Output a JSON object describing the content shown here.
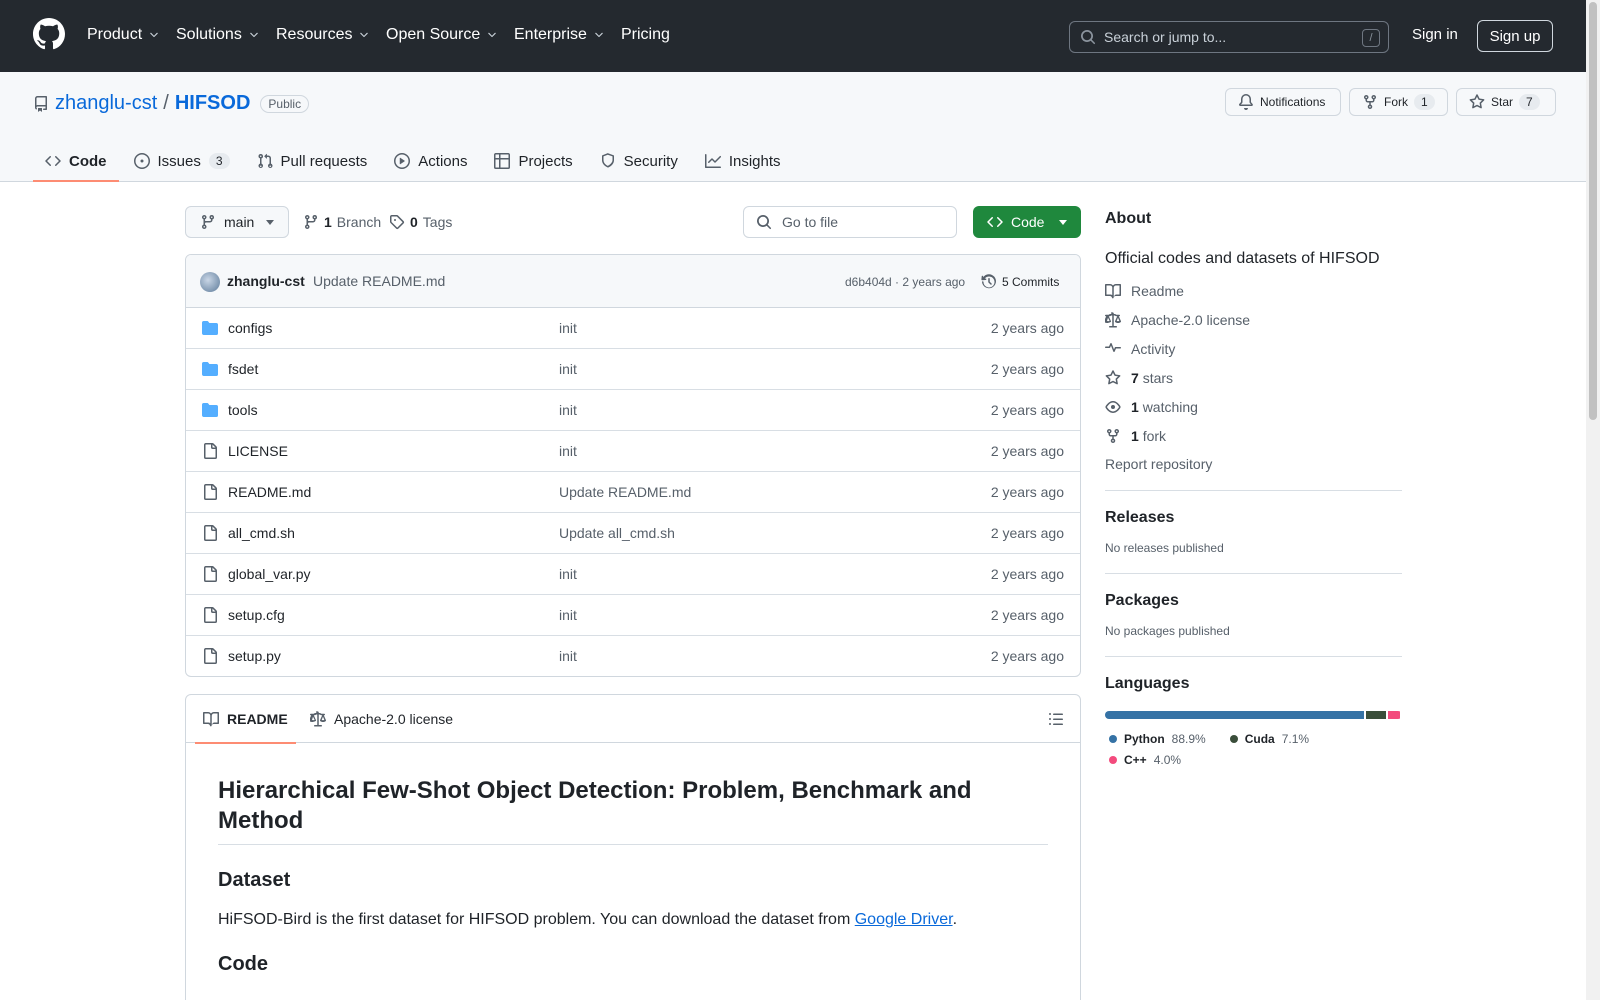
{
  "header": {
    "nav": [
      {
        "label": "Product",
        "dropdown": true
      },
      {
        "label": "Solutions",
        "dropdown": true
      },
      {
        "label": "Resources",
        "dropdown": true
      },
      {
        "label": "Open Source",
        "dropdown": true
      },
      {
        "label": "Enterprise",
        "dropdown": true
      },
      {
        "label": "Pricing",
        "dropdown": false
      }
    ],
    "search_placeholder": "Search or jump to...",
    "search_shortcut": "/",
    "sign_in": "Sign in",
    "sign_up": "Sign up"
  },
  "repo": {
    "owner": "zhanglu-cst",
    "separator": "/",
    "name": "HIFSOD",
    "visibility": "Public",
    "notifications_label": "Notifications",
    "fork_label": "Fork",
    "fork_count": "1",
    "star_label": "Star",
    "star_count": "7"
  },
  "tabs": [
    {
      "label": "Code",
      "icon": "code-icon",
      "active": true,
      "count": ""
    },
    {
      "label": "Issues",
      "icon": "issue-icon",
      "active": false,
      "count": "3"
    },
    {
      "label": "Pull requests",
      "icon": "pull-request-icon",
      "active": false,
      "count": ""
    },
    {
      "label": "Actions",
      "icon": "play-icon",
      "active": false,
      "count": ""
    },
    {
      "label": "Projects",
      "icon": "table-icon",
      "active": false,
      "count": ""
    },
    {
      "label": "Security",
      "icon": "shield-icon",
      "active": false,
      "count": ""
    },
    {
      "label": "Insights",
      "icon": "graph-icon",
      "active": false,
      "count": ""
    }
  ],
  "toolbar": {
    "branch": "main",
    "branch_count": "1",
    "branch_label": "Branch",
    "tag_count": "0",
    "tag_label": "Tags",
    "goto_placeholder": "Go to file",
    "code_button": "Code"
  },
  "last_commit": {
    "author": "zhanglu-cst",
    "message": "Update README.md",
    "meta": "d6b404d · 2 years ago",
    "commits": "5 Commits"
  },
  "files": [
    {
      "name": "configs",
      "type": "dir",
      "message": "init",
      "time": "2 years ago"
    },
    {
      "name": "fsdet",
      "type": "dir",
      "message": "init",
      "time": "2 years ago"
    },
    {
      "name": "tools",
      "type": "dir",
      "message": "init",
      "time": "2 years ago"
    },
    {
      "name": "LICENSE",
      "type": "file",
      "message": "init",
      "time": "2 years ago"
    },
    {
      "name": "README.md",
      "type": "file",
      "message": "Update README.md",
      "time": "2 years ago"
    },
    {
      "name": "all_cmd.sh",
      "type": "file",
      "message": "Update all_cmd.sh",
      "time": "2 years ago"
    },
    {
      "name": "global_var.py",
      "type": "file",
      "message": "init",
      "time": "2 years ago"
    },
    {
      "name": "setup.cfg",
      "type": "file",
      "message": "init",
      "time": "2 years ago"
    },
    {
      "name": "setup.py",
      "type": "file",
      "message": "init",
      "time": "2 years ago"
    }
  ],
  "readme": {
    "tab_readme": "README",
    "tab_license": "Apache-2.0 license",
    "title": "Hierarchical Few-Shot Object Detection: Problem, Benchmark and Method",
    "h_dataset": "Dataset",
    "dataset_text": "HiFSOD-Bird is the first dataset for HIFSOD problem. You can download the dataset from ",
    "dataset_link": "Google Driver",
    "dataset_end": ".",
    "h_code": "Code"
  },
  "about": {
    "title": "About",
    "description": "Official codes and datasets of HIFSOD",
    "readme": "Readme",
    "license": "Apache-2.0 license",
    "activity": "Activity",
    "stars_count": "7",
    "stars_label": "stars",
    "watching_count": "1",
    "watching_label": "watching",
    "fork_count": "1",
    "fork_label": "fork",
    "report": "Report repository"
  },
  "releases": {
    "title": "Releases",
    "empty": "No releases published"
  },
  "packages": {
    "title": "Packages",
    "empty": "No packages published"
  },
  "languages": {
    "title": "Languages",
    "items": [
      {
        "name": "Python",
        "percent": "88.9%",
        "value": 88.9,
        "color": "#3572A5"
      },
      {
        "name": "Cuda",
        "percent": "7.1%",
        "value": 7.1,
        "color": "#3A4E3A"
      },
      {
        "name": "C++",
        "percent": "4.0%",
        "value": 4.0,
        "color": "#f34b7d"
      }
    ]
  }
}
